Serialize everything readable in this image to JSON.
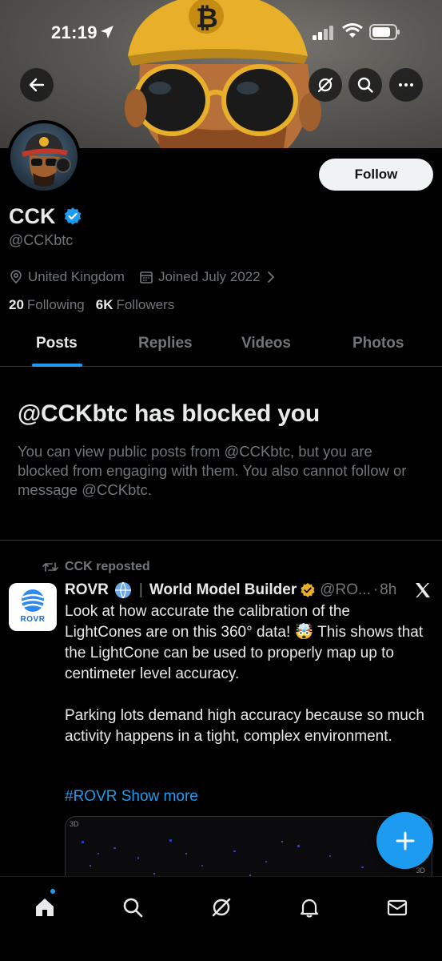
{
  "status_bar": {
    "time": "21:19"
  },
  "header": {
    "follow_label": "Follow"
  },
  "profile": {
    "name": "CCK",
    "handle": "@CCKbtc",
    "location": "United Kingdom",
    "joined": "Joined July 2022",
    "following_count": "20",
    "following_label": "Following",
    "followers_count": "6K",
    "followers_label": "Followers"
  },
  "tabs": [
    {
      "label": "Posts",
      "active": true
    },
    {
      "label": "Replies",
      "active": false
    },
    {
      "label": "Videos",
      "active": false
    },
    {
      "label": "Photos",
      "active": false
    }
  ],
  "blocked": {
    "title": "@CCKbtc has blocked you",
    "description": "You can view public posts from @CCKbtc, but you are blocked from engaging with them. You also cannot follow or message @CCKbtc."
  },
  "post": {
    "repost_label": "CCK reposted",
    "avatar_label": "ROVR",
    "author_name": "ROVR",
    "affiliation": "World Model Builder",
    "author_handle": "@RO...",
    "time_sep": "·",
    "time": "8h",
    "paragraph_1": "Look at how accurate the calibration of the LightCones are on this 360° data! 🤯 This shows that the LightCone can be used to properly map up to centimeter level accuracy.",
    "paragraph_2": "Parking lots demand high accuracy because so much activity happens in a tight, complex environment.",
    "hashtag": "#ROVR",
    "show_more": "Show more",
    "media_label": "3D",
    "media_label_2": "3D"
  },
  "colors": {
    "accent": "#1d9bf0",
    "background": "#000000",
    "text": "#e7e9ea",
    "muted": "#71767b",
    "gold_badge": "#e8b02a"
  },
  "icons": {
    "back": "arrow-left-icon",
    "grok": "grok-icon",
    "search": "search-icon",
    "more": "more-horizontal-icon",
    "location": "location-pin-icon",
    "calendar": "calendar-icon",
    "repost": "repost-icon",
    "x_logo": "x-logo-icon",
    "compose": "plus-icon",
    "nav": [
      "home-icon",
      "search-icon",
      "grok-icon",
      "notifications-icon",
      "messages-icon"
    ]
  }
}
